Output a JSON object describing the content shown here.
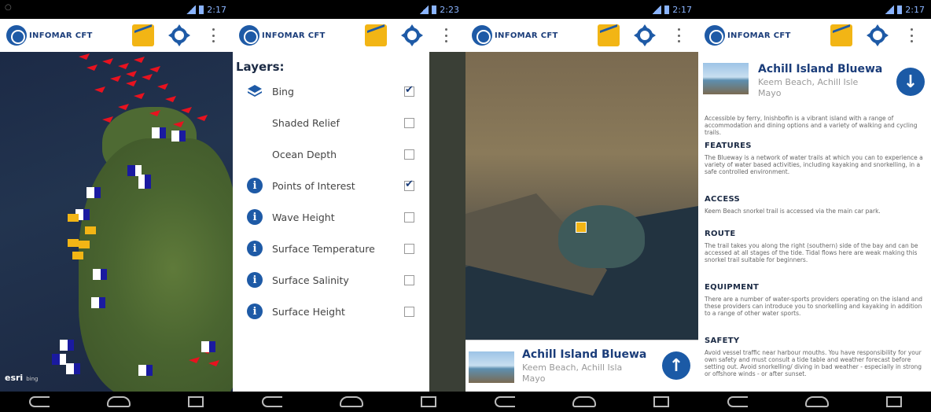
{
  "app": {
    "name": "INFOMAR CFT"
  },
  "statusbar": {
    "panels": [
      "2:17",
      "2:23",
      "2:17",
      "2:17"
    ]
  },
  "icons": {
    "logo": "infomar-logo-icon",
    "wave": "wave-chart-icon",
    "locate": "crosshair-icon",
    "menu": "overflow-menu-icon"
  },
  "colors": {
    "brand_blue": "#1b3d7a",
    "accent_yellow": "#f2b515",
    "poi_red": "#e8121f"
  },
  "map_panel": {
    "attribution": "esri",
    "attribution_sub": "bing"
  },
  "layers_panel": {
    "title": "Layers:",
    "items": [
      {
        "label": "Bing",
        "icon": "layers-icon",
        "checked": true
      },
      {
        "label": "Shaded Relief",
        "icon": "",
        "checked": false
      },
      {
        "label": "Ocean Depth",
        "icon": "",
        "checked": false
      },
      {
        "label": "Points of Interest",
        "icon": "info-icon",
        "checked": true
      },
      {
        "label": "Wave Height",
        "icon": "info-icon",
        "checked": false
      },
      {
        "label": "Surface Temperature",
        "icon": "info-icon",
        "checked": false
      },
      {
        "label": "Surface Salinity",
        "icon": "info-icon",
        "checked": false
      },
      {
        "label": "Surface Height",
        "icon": "info-icon",
        "checked": false
      }
    ]
  },
  "poi_card": {
    "title": "Achill Island Bluewa",
    "subtitle_1": "Keem Beach, Achill Isla",
    "subtitle_2": "Mayo"
  },
  "detail_panel": {
    "title": "Achill Island Bluewa",
    "subtitle_1": "Keem Beach, Achill Isle",
    "subtitle_2": "Mayo",
    "intro": "Accessible by ferry, Inishbofin is a vibrant island with a range of accommodation and dining options and a variety of walking and cycling trails.",
    "sections": [
      {
        "head": "FEATURES",
        "body": "The Blueway is a network of water trails at which you can to experience a variety of water based activities, including kayaking and snorkelling, in a safe controlled environment."
      },
      {
        "head": "ACCESS",
        "body": "Keem Beach snorkel trail is accessed via the main car park."
      },
      {
        "head": "ROUTE",
        "body": "The trail takes you along the right (southern) side of the bay and can be accessed at all stages of the tide. Tidal flows here are weak making this snorkel trail suitable for beginners."
      },
      {
        "head": "EQUIPMENT",
        "body": "There are a number of water-sports providers operating on the island and these providers can introduce you to snorkelling and kayaking in addition to a range of other water sports."
      },
      {
        "head": "SAFETY",
        "body": "Avoid vessel traffic near harbour mouths. You have responsibility for your own safety and must consult a tide table and weather forecast before setting out. Avoid snorkelling/ diving in bad weather - especially in strong or offshore winds - or after sunset."
      }
    ]
  }
}
